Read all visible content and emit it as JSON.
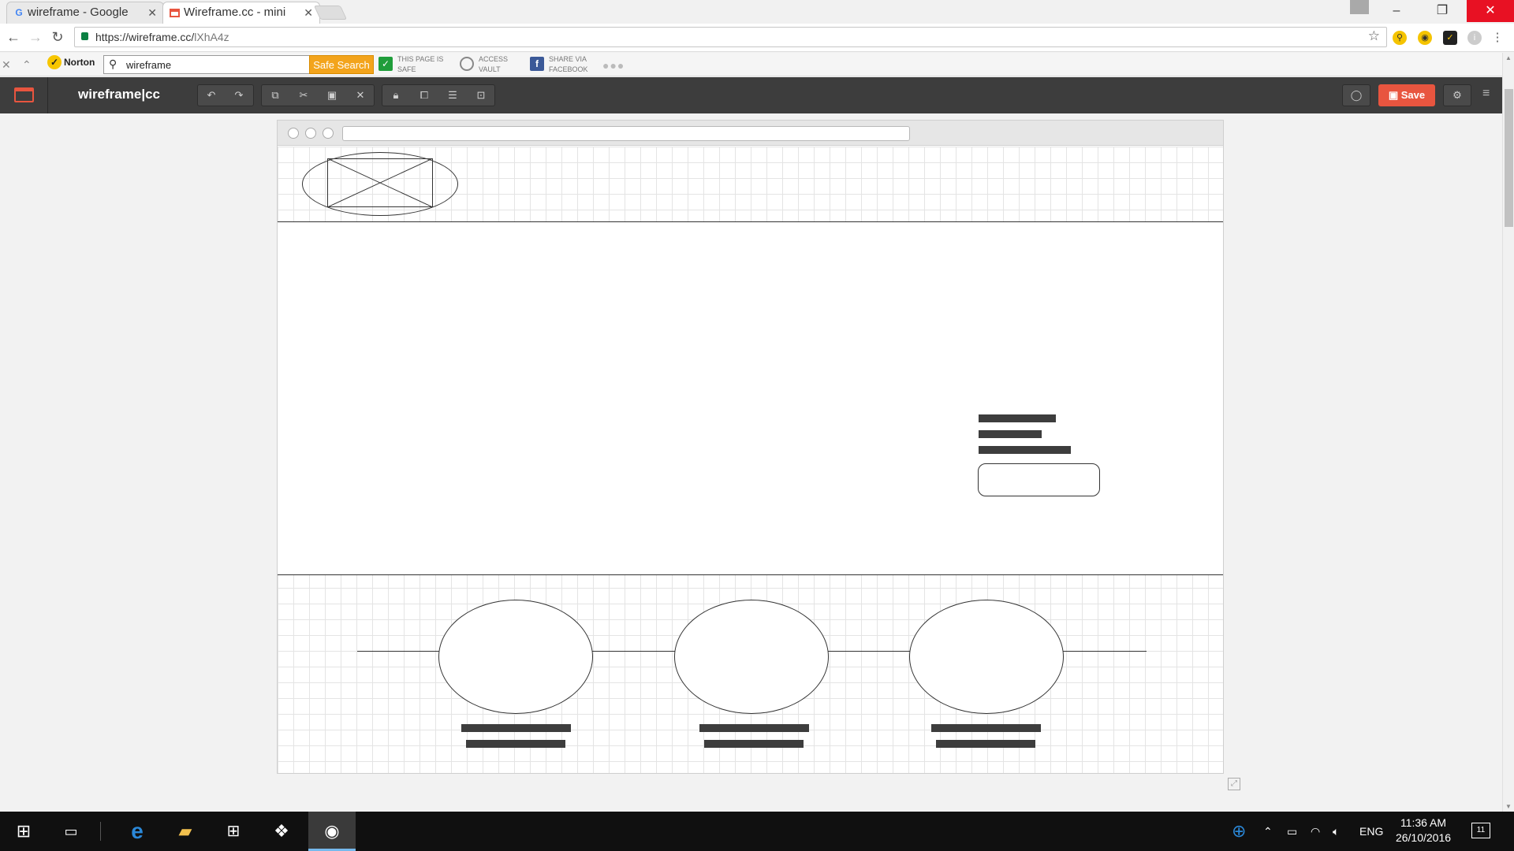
{
  "browser": {
    "tabs": [
      {
        "title": "wireframe - Google",
        "favicon": "google-icon"
      },
      {
        "title": "Wireframe.cc - mini",
        "favicon": "wireframecc-icon"
      }
    ],
    "url_host": "https://wireframe.cc/",
    "url_path": "lXhA4z",
    "window_controls": {
      "minimize": "–",
      "maximize": "❐",
      "close": "✕"
    }
  },
  "norton": {
    "brand": "Norton",
    "search_value": "wireframe",
    "safe_search_label": "Safe Search",
    "page_safe": [
      "THIS PAGE IS",
      "SAFE"
    ],
    "vault": [
      "ACCESS",
      "VAULT"
    ],
    "share": [
      "SHARE VIA",
      "FACEBOOK"
    ]
  },
  "app": {
    "brand": "wireframe|cc",
    "save_label": "Save",
    "accent": "#e8553f"
  },
  "wireframe_page": {
    "image_placeholder": "image-placeholder-icon",
    "columns": 3
  },
  "taskbar": {
    "language": "ENG",
    "time": "11:36 AM",
    "date": "26/10/2016",
    "notifications": "11"
  }
}
